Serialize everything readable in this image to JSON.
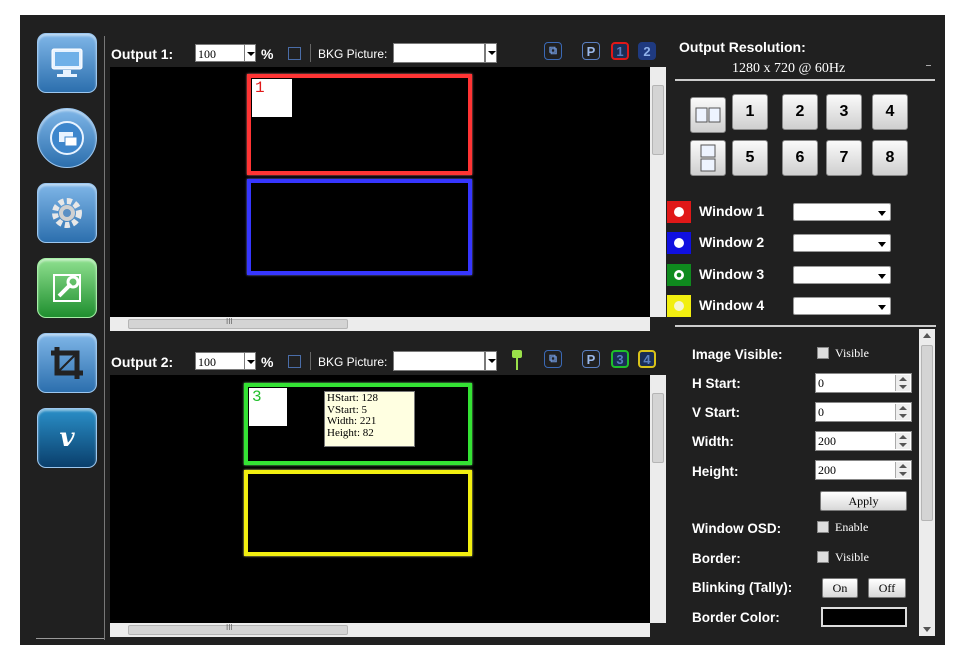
{
  "output1": {
    "label": "Output 1:",
    "zoom": "100",
    "pct": "%",
    "bkg_label": "BKG Picture:",
    "bkg_value": "",
    "window_tags": [
      "1"
    ],
    "badges": [
      "P",
      "1",
      "2"
    ]
  },
  "output2": {
    "label": "Output 2:",
    "zoom": "100",
    "pct": "%",
    "bkg_label": "BKG Picture:",
    "bkg_value": "",
    "window_tags": [
      "3"
    ],
    "badges": [
      "P",
      "3",
      "4"
    ],
    "tooltip": [
      "HStart: 128",
      "VStart: 5",
      "Width: 221",
      "Height: 82"
    ]
  },
  "scroll_grip": "III",
  "resolution": {
    "title": "Output Resolution:",
    "value": "1280 x 720 @ 60Hz"
  },
  "layouts": [
    "1",
    "2",
    "3",
    "4",
    "5",
    "6",
    "7",
    "8"
  ],
  "windows": [
    {
      "label": "Window 1",
      "color": "#e01818"
    },
    {
      "label": "Window 2",
      "color": "#1010e0"
    },
    {
      "label": "Window 3",
      "color": "#0f8a1e"
    },
    {
      "label": "Window 4",
      "color": "#f2ef10"
    }
  ],
  "properties": {
    "image_visible": "Image Visible:",
    "image_visible_chk": "Visible",
    "h_start": "H Start:",
    "h_start_val": "0",
    "v_start": "V Start:",
    "v_start_val": "0",
    "width": "Width:",
    "width_val": "200",
    "height": "Height:",
    "height_val": "200",
    "apply": "Apply",
    "osd": "Window OSD:",
    "osd_chk": "Enable",
    "border": "Border:",
    "border_chk": "Visible",
    "blinking": "Blinking (Tally):",
    "on": "On",
    "off": "Off",
    "border_color": "Border Color:"
  },
  "colors": {
    "accent_red": "#ff2a2a",
    "accent_blue": "#2a2aff",
    "accent_green": "#2ae52a",
    "accent_yellow": "#f2ef10",
    "panel": "#202020"
  }
}
